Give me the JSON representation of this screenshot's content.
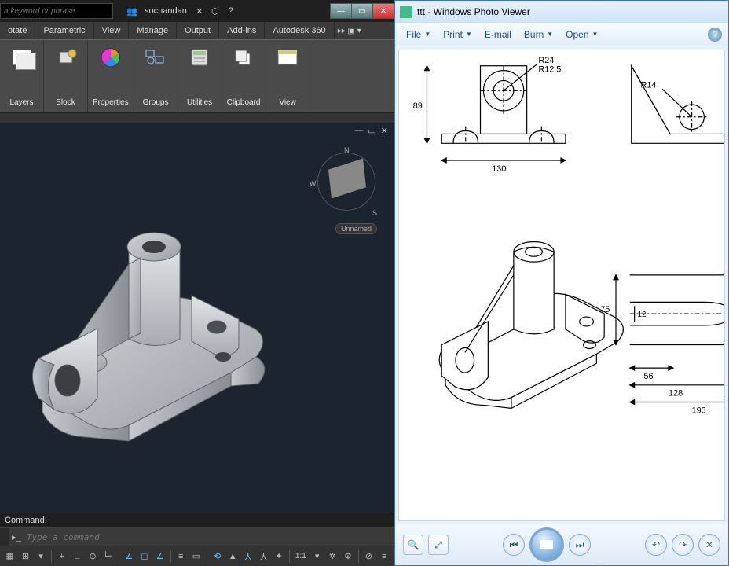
{
  "acad": {
    "search_placeholder": "a keyword or phrase",
    "user": "socnandan",
    "tabs": [
      "otate",
      "Parametric",
      "View",
      "Manage",
      "Output",
      "Add-ins",
      "Autodesk 360"
    ],
    "tabs_extra": "▸▸  ▣ ▾",
    "ribbon": {
      "layers": "Layers",
      "block": "Block",
      "properties": "Properties",
      "groups": "Groups",
      "utilities": "Utilities",
      "clipboard": "Clipboard",
      "view": "View"
    },
    "viewcube_label": "Unnamed",
    "compass": {
      "n": "N",
      "w": "W",
      "s": "S"
    },
    "cmd_label": "Command:",
    "cmd_placeholder": "Type a command",
    "status_scale": "1:1",
    "winbtn": {
      "min": "—",
      "max": "▭",
      "close": "✕"
    }
  },
  "wpv": {
    "title": "ttt - Windows Photo Viewer",
    "menu": {
      "file": "File",
      "print": "Print",
      "email": "E-mail",
      "burn": "Burn",
      "open": "Open"
    },
    "drawing_dims": {
      "R24": "R24",
      "R12_5": "R12.5",
      "R14": "R14",
      "d89": "89",
      "d130": "130",
      "d75": "75",
      "d12": "12",
      "d56": "56",
      "d128": "128",
      "d193": "193"
    }
  }
}
